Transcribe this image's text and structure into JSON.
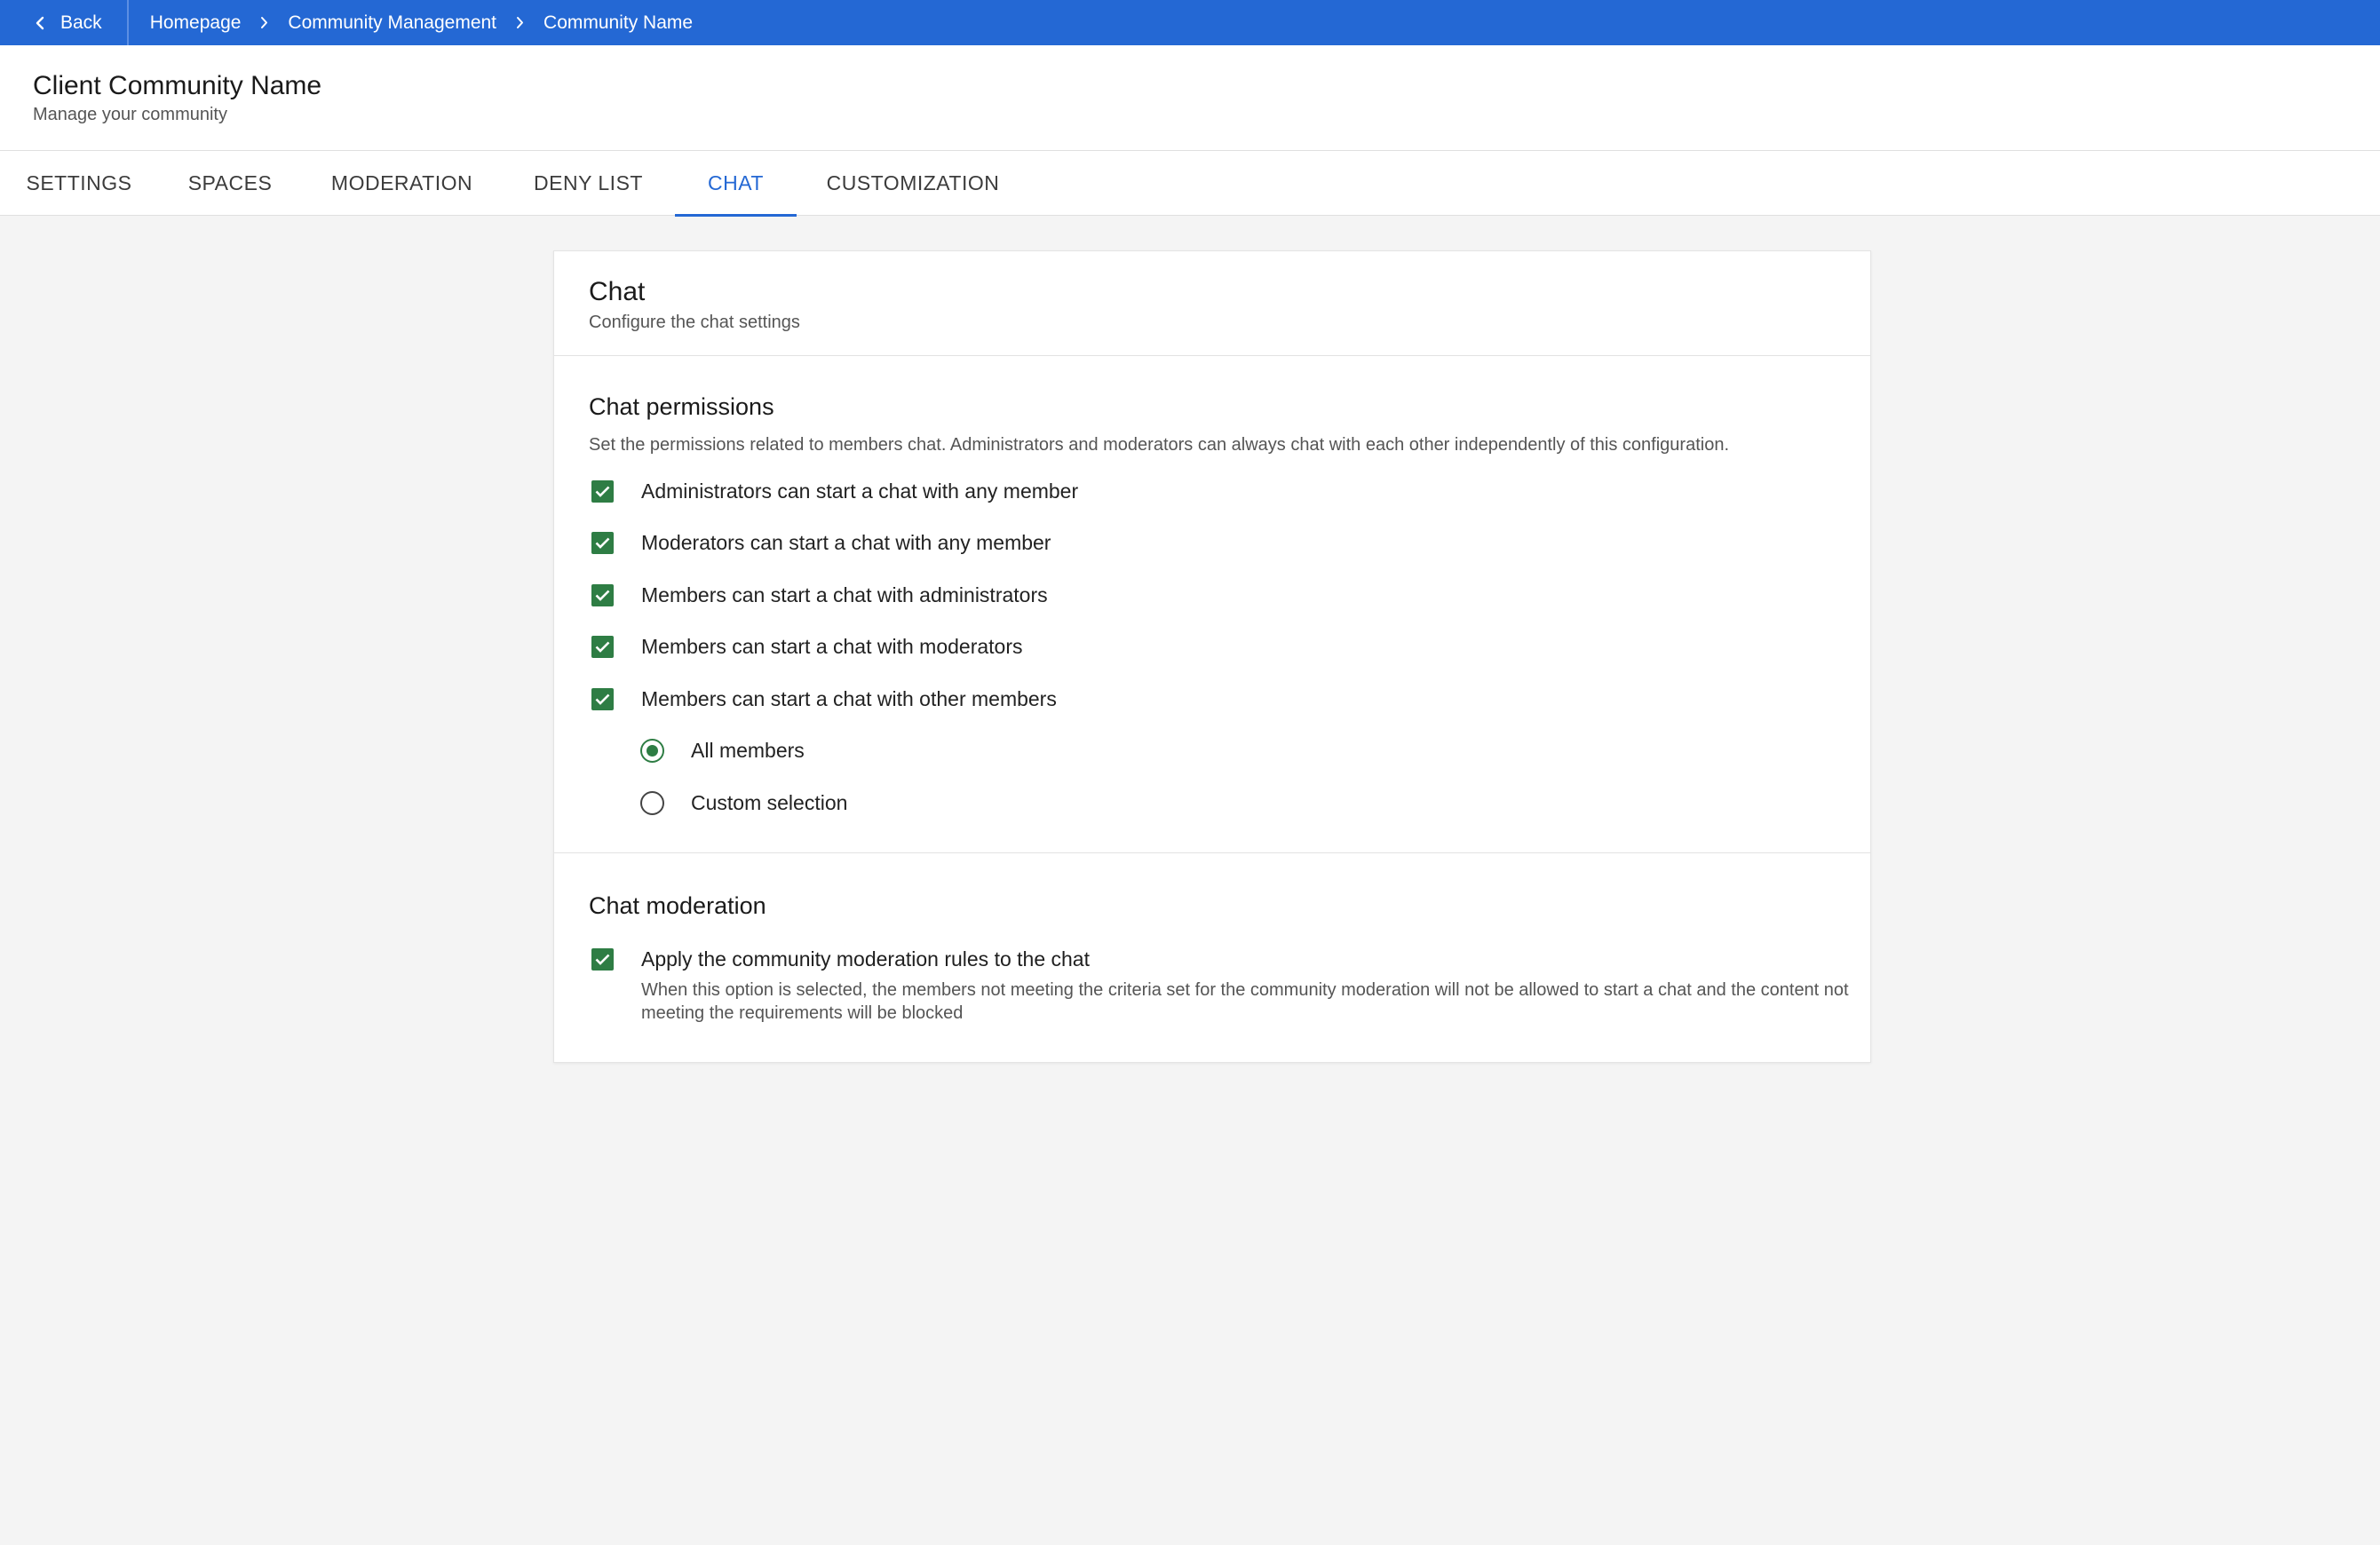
{
  "topbar": {
    "back_label": "Back",
    "breadcrumbs": [
      "Homepage",
      "Community Management",
      "Community Name"
    ],
    "color": "#2468d4"
  },
  "header": {
    "title": "Client Community Name",
    "subtitle": "Manage your community"
  },
  "tabs": [
    {
      "label": "SETTINGS",
      "active": false
    },
    {
      "label": "SPACES",
      "active": false
    },
    {
      "label": "MODERATION",
      "active": false
    },
    {
      "label": "DENY LIST",
      "active": false
    },
    {
      "label": "CHAT",
      "active": true
    },
    {
      "label": "CUSTOMIZATION",
      "active": false
    }
  ],
  "card": {
    "title": "Chat",
    "subtitle": "Configure the chat settings"
  },
  "permissions": {
    "title": "Chat permissions",
    "description": "Set the permissions related to members chat. Administrators and moderators can always chat with each other independently of this configuration.",
    "options": [
      {
        "label": "Administrators can start a chat with any member",
        "checked": true
      },
      {
        "label": "Moderators can start a chat with any member",
        "checked": true
      },
      {
        "label": "Members can start a chat with administrators",
        "checked": true
      },
      {
        "label": "Members can start a chat with moderators",
        "checked": true
      },
      {
        "label": "Members can start a chat with other members",
        "checked": true
      }
    ],
    "member_scope": [
      {
        "label": "All members",
        "selected": true
      },
      {
        "label": "Custom selection",
        "selected": false
      }
    ]
  },
  "moderation": {
    "title": "Chat moderation",
    "option_label": "Apply the community moderation rules to the chat",
    "option_checked": true,
    "help_text": "When this option is selected, the members not meeting the criteria set for the community moderation will not be allowed to start a chat and the content not meeting the requirements will be blocked"
  },
  "colors": {
    "accent": "#2468d4",
    "checkbox": "#2e7d44"
  }
}
